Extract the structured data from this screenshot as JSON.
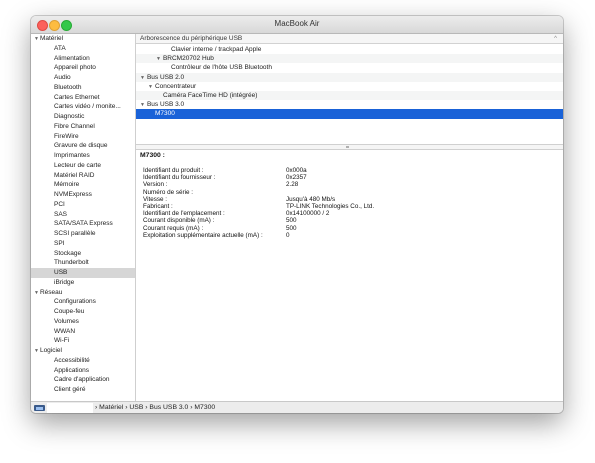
{
  "window": {
    "title": "MacBook Air"
  },
  "sidebar": {
    "rows": [
      {
        "label": "Matériel",
        "type": "group"
      },
      {
        "label": "ATA",
        "type": "item"
      },
      {
        "label": "Alimentation",
        "type": "item"
      },
      {
        "label": "Appareil photo",
        "type": "item"
      },
      {
        "label": "Audio",
        "type": "item"
      },
      {
        "label": "Bluetooth",
        "type": "item"
      },
      {
        "label": "Cartes Ethernet",
        "type": "item"
      },
      {
        "label": "Cartes vidéo / monite...",
        "type": "item"
      },
      {
        "label": "Diagnostic",
        "type": "item"
      },
      {
        "label": "Fibre Channel",
        "type": "item"
      },
      {
        "label": "FireWire",
        "type": "item"
      },
      {
        "label": "Gravure de disque",
        "type": "item"
      },
      {
        "label": "Imprimantes",
        "type": "item"
      },
      {
        "label": "Lecteur de carte",
        "type": "item"
      },
      {
        "label": "Matériel RAID",
        "type": "item"
      },
      {
        "label": "Mémoire",
        "type": "item"
      },
      {
        "label": "NVMExpress",
        "type": "item"
      },
      {
        "label": "PCI",
        "type": "item"
      },
      {
        "label": "SAS",
        "type": "item"
      },
      {
        "label": "SATA/SATA Express",
        "type": "item"
      },
      {
        "label": "SCSI parallèle",
        "type": "item"
      },
      {
        "label": "SPI",
        "type": "item"
      },
      {
        "label": "Stockage",
        "type": "item"
      },
      {
        "label": "Thunderbolt",
        "type": "item"
      },
      {
        "label": "USB",
        "type": "item",
        "selected": true
      },
      {
        "label": "iBridge",
        "type": "item"
      },
      {
        "label": "Réseau",
        "type": "group"
      },
      {
        "label": "Configurations",
        "type": "item"
      },
      {
        "label": "Coupe-feu",
        "type": "item"
      },
      {
        "label": "Volumes",
        "type": "item"
      },
      {
        "label": "WWAN",
        "type": "item"
      },
      {
        "label": "Wi-Fi",
        "type": "item"
      },
      {
        "label": "Logiciel",
        "type": "group"
      },
      {
        "label": "Accessibilité",
        "type": "item"
      },
      {
        "label": "Applications",
        "type": "item"
      },
      {
        "label": "Cadre d'application",
        "type": "item"
      },
      {
        "label": "Client géré",
        "type": "item"
      }
    ]
  },
  "tree": {
    "header": "Arborescence du périphérique USB",
    "rows": [
      {
        "label": "Clavier interne / trackpad Apple",
        "indent": 3,
        "expander": false
      },
      {
        "label": "BRCM20702 Hub",
        "indent": 2,
        "expander": true
      },
      {
        "label": "Contrôleur de l'hôte USB Bluetooth",
        "indent": 3,
        "expander": false
      },
      {
        "label": "Bus USB 2.0",
        "indent": 0,
        "expander": true
      },
      {
        "label": "Concentrateur",
        "indent": 1,
        "expander": true
      },
      {
        "label": "Caméra FaceTime HD (intégrée)",
        "indent": 2,
        "expander": false
      },
      {
        "label": "Bus USB 3.0",
        "indent": 0,
        "expander": true
      },
      {
        "label": "M7300",
        "indent": 1,
        "expander": false,
        "selected": true
      }
    ]
  },
  "detail": {
    "title": "M7300 :",
    "fields": [
      {
        "key": "Identifiant du produit :",
        "value": "0x000a"
      },
      {
        "key": "Identifiant du fournisseur :",
        "value": "0x2357"
      },
      {
        "key": "Version :",
        "value": "2.28"
      },
      {
        "key": "Numéro de série :",
        "value": ""
      },
      {
        "key": "Vitesse :",
        "value": "Jusqu'à 480 Mb/s"
      },
      {
        "key": "Fabricant :",
        "value": "TP-LINK Technologies Co., Ltd."
      },
      {
        "key": "Identifiant de l'emplacement :",
        "value": "0x14100000 / 2"
      },
      {
        "key": "Courant disponible (mA) :",
        "value": "500"
      },
      {
        "key": "Courant requis (mA) :",
        "value": "500"
      },
      {
        "key": "Exploitation supplémentaire actuelle (mA) :",
        "value": "0"
      }
    ]
  },
  "statusbar": {
    "breadcrumb": [
      "Matériel",
      "USB",
      "Bus USB 3.0",
      "M7300"
    ],
    "separator": "›"
  }
}
